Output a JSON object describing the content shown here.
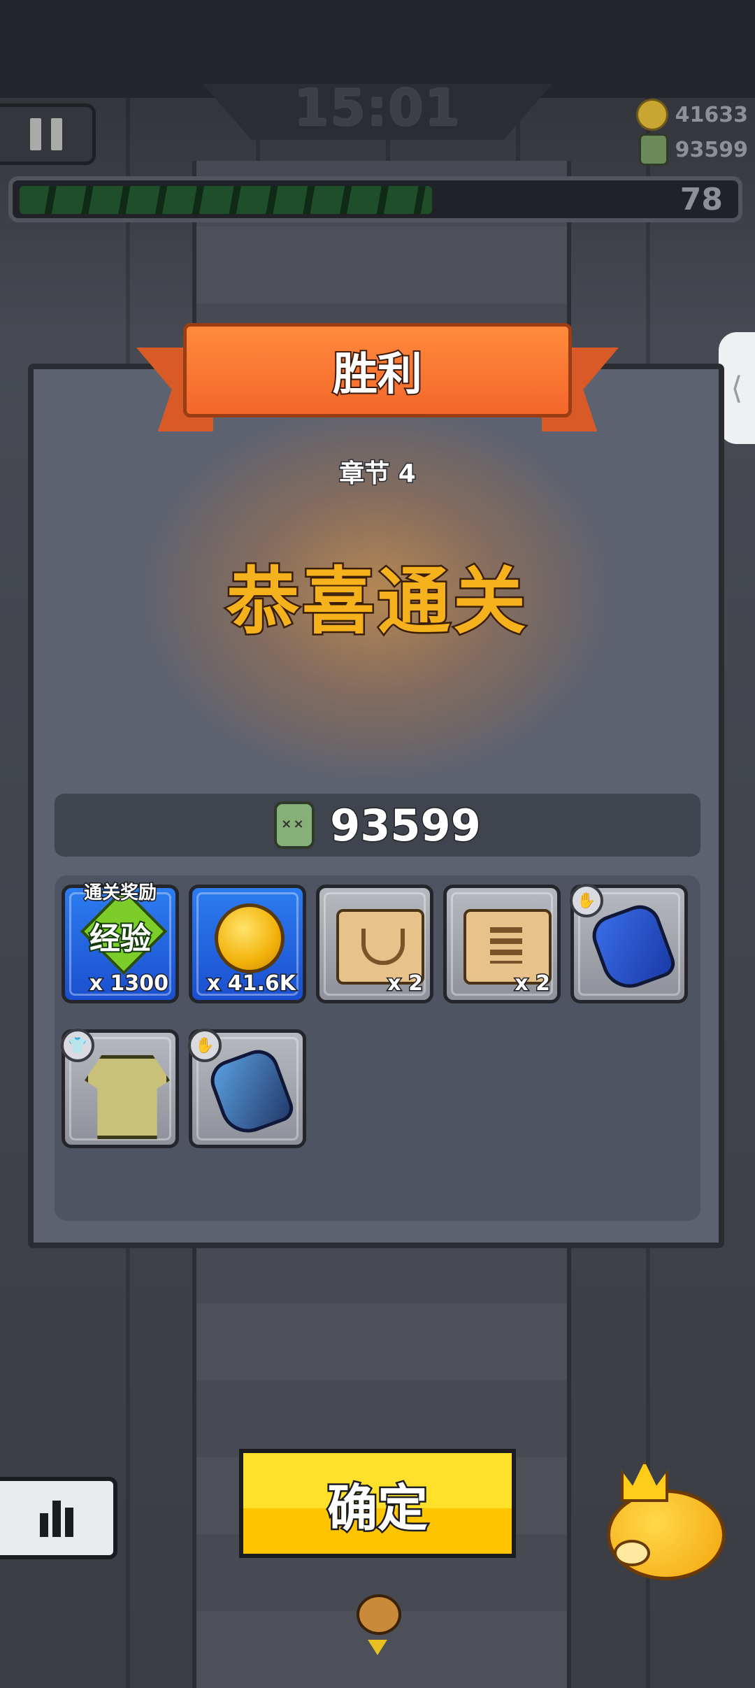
{
  "hud": {
    "timer": "15:01",
    "coins": "41633",
    "kills": "93599",
    "level": "78",
    "xp_progress": 0.55
  },
  "dialog": {
    "title": "胜利",
    "chapter": "章节 4",
    "congrats": "恭喜通关",
    "kill_count": "93599",
    "clear_reward_label": "通关奖励",
    "rewards": [
      {
        "type": "exp",
        "label": "经验",
        "qty": "x 1300",
        "bg": "blue"
      },
      {
        "type": "coin",
        "qty": "x 41.6K",
        "bg": "blue"
      },
      {
        "type": "scroll",
        "qty": "x 2",
        "bg": "grey"
      },
      {
        "type": "scroll",
        "qty": "x 2",
        "bg": "grey"
      },
      {
        "type": "glove",
        "qty": "",
        "bg": "grey"
      },
      {
        "type": "shirt",
        "qty": "",
        "bg": "grey"
      },
      {
        "type": "glove",
        "qty": "",
        "bg": "grey"
      }
    ]
  },
  "buttons": {
    "confirm": "确定"
  },
  "colors": {
    "ribbon": "#f4672b",
    "congrats": "#f6b21c",
    "confirm": "#ffd21a",
    "reward_blue": "#2d7cf0"
  }
}
